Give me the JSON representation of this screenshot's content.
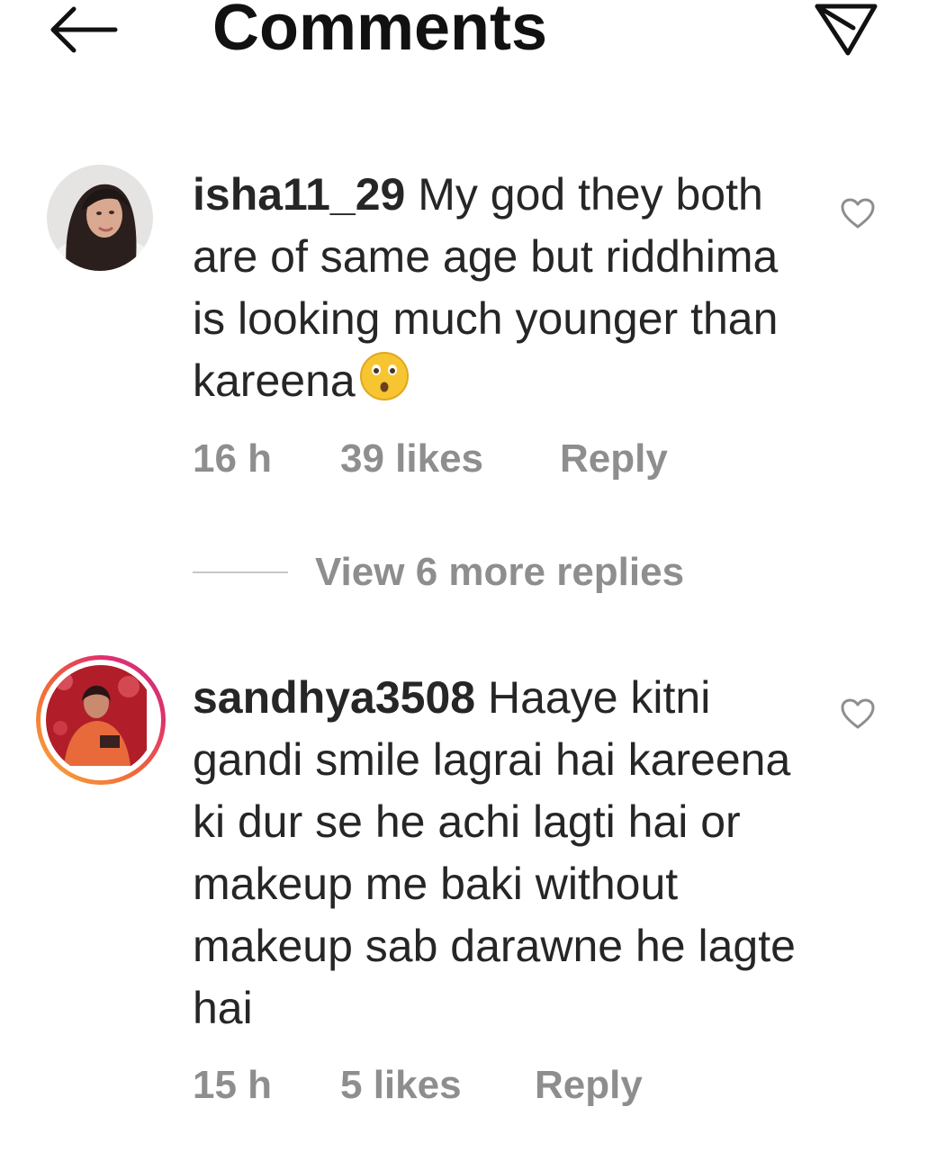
{
  "header": {
    "title": "Comments",
    "back_icon": "arrow-left-icon",
    "send_icon": "paper-plane-icon"
  },
  "comments": [
    {
      "username": "isha11_29",
      "text": "My god they both are of same age but riddhima is looking much younger than kareena",
      "emoji": "hushed-face-emoji",
      "time": "16 h",
      "likes": "39 likes",
      "reply_label": "Reply"
    },
    {
      "username": "sandhya3508",
      "text": "Haaye kitni gandi smile lagrai hai kareena ki dur se he achi lagti hai or makeup me baki without makeup sab darawne he lagte hai",
      "time": "15 h",
      "likes": "5 likes",
      "reply_label": "Reply"
    }
  ],
  "view_replies": {
    "label": "View 6 more replies"
  },
  "colors": {
    "text_primary": "#262626",
    "text_secondary": "#8e8e8e",
    "story_ring_start": "#f9ae3a",
    "story_ring_end": "#c13584"
  }
}
